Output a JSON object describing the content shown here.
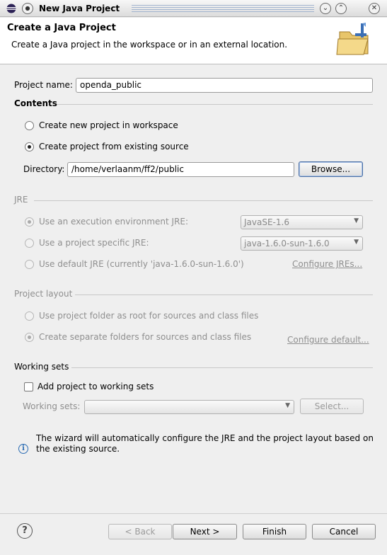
{
  "window": {
    "title": "New Java Project",
    "minimize_glyph": "⌄",
    "maximize_glyph": "⌃",
    "close_glyph": "✕"
  },
  "banner": {
    "heading": "Create a Java Project",
    "description": "Create a Java project in the workspace or in an external location."
  },
  "project": {
    "name_label": "Project name:",
    "name_value": "openda_public"
  },
  "contents": {
    "title": "Contents",
    "option_new": "Create new project in workspace",
    "option_existing": "Create project from existing source",
    "directory_label": "Directory:",
    "directory_value": "/home/verlaanm/ff2/public",
    "browse_label": "Browse..."
  },
  "jre": {
    "title": "JRE",
    "option_env": "Use an execution environment JRE:",
    "env_value": "JavaSE-1.6",
    "option_specific": "Use a project specific JRE:",
    "specific_value": "java-1.6.0-sun-1.6.0",
    "option_default": "Use default JRE (currently 'java-1.6.0-sun-1.6.0')",
    "configure_link": "Configure JREs..."
  },
  "layout": {
    "title": "Project layout",
    "option_root": "Use project folder as root for sources and class files",
    "option_separate": "Create separate folders for sources and class files",
    "configure_link": "Configure default..."
  },
  "working_sets": {
    "title": "Working sets",
    "add_label": "Add project to working sets",
    "sets_label": "Working sets:",
    "sets_value": "",
    "select_label": "Select..."
  },
  "info": {
    "line1": "The wizard will automatically configure the JRE and the project layout based on",
    "line2": "the existing source."
  },
  "footer": {
    "help_glyph": "?",
    "back_label": "< Back",
    "next_label": "Next >",
    "finish_label": "Finish",
    "cancel_label": "Cancel"
  }
}
